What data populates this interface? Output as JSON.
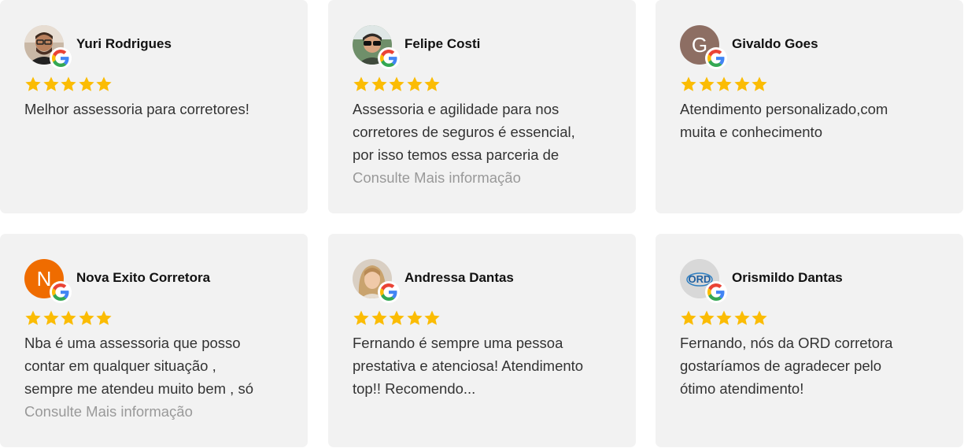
{
  "colors": {
    "card_bg": "#f2f2f2",
    "star": "#fbbc04",
    "more_link": "#999999",
    "google_blue": "#4285f4",
    "google_red": "#ea4335",
    "google_yellow": "#fbbc05",
    "google_green": "#34a853"
  },
  "reviews": [
    {
      "name": "Yuri Rodrigues",
      "avatar_icon": "photo-avatar-man-glasses",
      "rating": 5,
      "text_lines": [
        "Melhor assessoria para corretores!"
      ],
      "more": ""
    },
    {
      "name": "Felipe Costi",
      "avatar_icon": "photo-avatar-man-sunglasses",
      "rating": 5,
      "text_lines": [
        "Assessoria e agilidade para nos",
        "corretores de seguros é essencial,",
        "por isso temos essa parceria de"
      ],
      "more": "Consulte Mais informação"
    },
    {
      "name": "Givaldo Goes",
      "avatar_letter": "G",
      "avatar_color": "#8d6e63",
      "rating": 5,
      "text_lines": [
        "Atendimento personalizado,com",
        "muita e conhecimento"
      ],
      "more": ""
    },
    {
      "name": "Nova Exito Corretora",
      "avatar_letter": "N",
      "avatar_color": "#ef6c00",
      "rating": 5,
      "text_lines": [
        "Nba é uma assessoria que posso",
        "contar em qualquer situação ,",
        "sempre me atendeu muito bem , só"
      ],
      "more": "Consulte Mais informação"
    },
    {
      "name": "Andressa Dantas",
      "avatar_icon": "photo-avatar-woman",
      "rating": 5,
      "text_lines": [
        "Fernando é sempre uma pessoa",
        "prestativa e atenciosa! Atendimento",
        "top!! Recomendo..."
      ],
      "more": ""
    },
    {
      "name": "Orismildo Dantas",
      "avatar_icon": "logo-avatar-ord",
      "avatar_logo_text": "ORD",
      "rating": 5,
      "text_lines": [
        "Fernando, nós da ORD corretora",
        "gostaríamos de agradecer pelo",
        "ótimo atendimento!"
      ],
      "more": ""
    }
  ]
}
